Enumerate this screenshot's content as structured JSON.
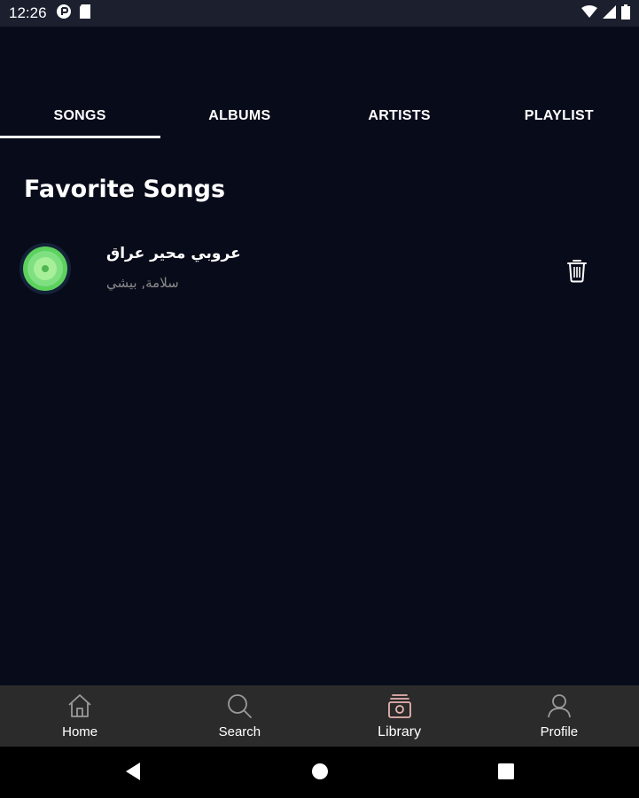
{
  "status_bar": {
    "time": "12:26",
    "left_icons": [
      "media-icon",
      "sd-card-icon"
    ],
    "right_icons": [
      "wifi-icon",
      "signal-icon",
      "battery-icon"
    ]
  },
  "tabs": [
    {
      "label": "SONGS",
      "active": true
    },
    {
      "label": "ALBUMS",
      "active": false
    },
    {
      "label": "ARTISTS",
      "active": false
    },
    {
      "label": "PLAYLIST",
      "active": false
    }
  ],
  "section_title": "Favorite Songs",
  "songs": [
    {
      "title": "عروبي محير عراق",
      "artist": "سلامة, بيشي",
      "thumbnail_icon": "vinyl-record-icon",
      "action_icon": "trash-icon"
    }
  ],
  "bottom_nav": [
    {
      "label": "Home",
      "icon": "home-icon",
      "active": false
    },
    {
      "label": "Search",
      "icon": "search-icon",
      "active": false
    },
    {
      "label": "Library",
      "icon": "library-icon",
      "active": true
    },
    {
      "label": "Profile",
      "icon": "profile-icon",
      "active": false
    }
  ],
  "system_nav": [
    "back-icon",
    "home-circle-icon",
    "recents-icon"
  ],
  "colors": {
    "background": "#080b1a",
    "status_bar": "#1b1f2e",
    "bottom_nav": "#2b2b2b",
    "library_accent": "#e8b4b0",
    "secondary_text": "#8a8a8a"
  }
}
